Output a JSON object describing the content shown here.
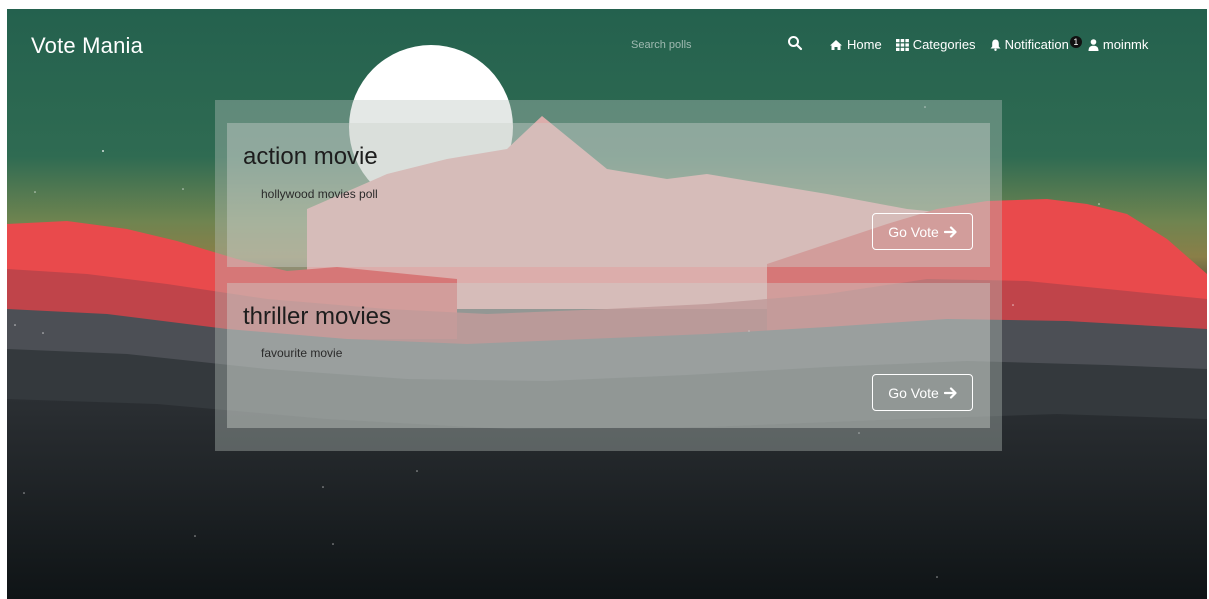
{
  "app": {
    "brand": "Vote Mania"
  },
  "search": {
    "placeholder": "Search polls",
    "icon": "search-icon"
  },
  "nav": {
    "home": {
      "label": "Home",
      "icon": "home-icon"
    },
    "categories": {
      "label": "Categories",
      "icon": "grid-icon"
    },
    "notification": {
      "label": "Notification",
      "icon": "bell-icon",
      "count": "1"
    },
    "user": {
      "label": "moinmk",
      "icon": "user-icon"
    }
  },
  "polls": [
    {
      "title": "action movie",
      "subtitle": "hollywood movies poll",
      "button_label": "Go Vote"
    },
    {
      "title": "thriller movies",
      "subtitle": "favourite movie",
      "button_label": "Go Vote"
    }
  ],
  "colors": {
    "sky_top": "#26634f",
    "mountain_red": "#e8494b",
    "mountain_pink": "#f2a3a3",
    "sun": "#ffffff",
    "ground_dark": "#141a1c",
    "text_light": "#ffffff",
    "text_dark": "#1d1d1d"
  }
}
